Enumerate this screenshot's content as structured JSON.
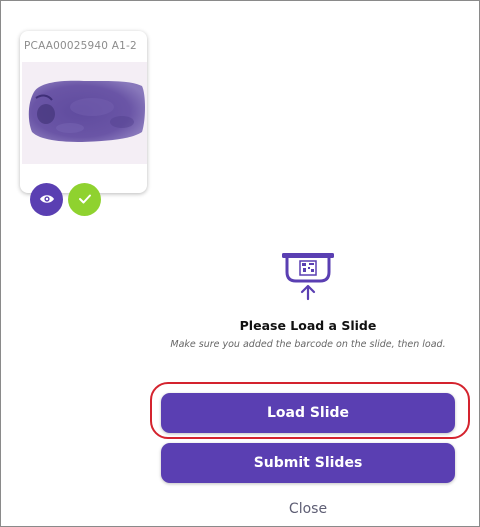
{
  "slide_card": {
    "slide_id": "PCAA00025940 A1-2",
    "view_icon": "eye-icon",
    "status_icon": "check-icon"
  },
  "load_panel": {
    "icon": "barcode-scanner-icon",
    "title": "Please Load a Slide",
    "subtitle": "Make sure you added the barcode on the slide, then load."
  },
  "actions": {
    "load_label": "Load Slide",
    "submit_label": "Submit Slides",
    "close_label": "Close"
  },
  "colors": {
    "primary": "#5a3fb2",
    "success": "#8fd22f",
    "highlight": "#d4232e"
  }
}
